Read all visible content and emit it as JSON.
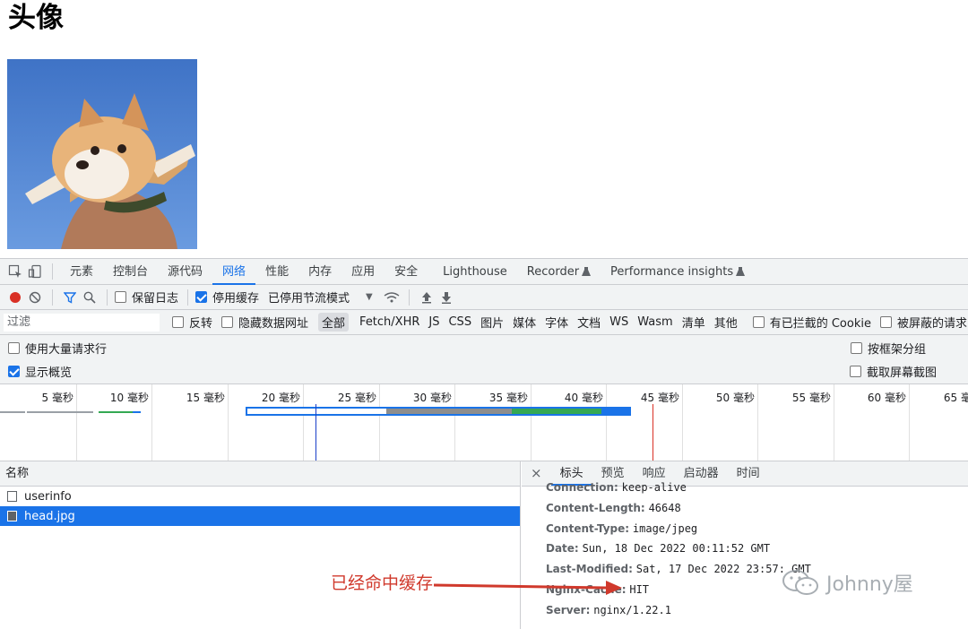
{
  "page": {
    "heading": "头像"
  },
  "devtools": {
    "main_tabs": [
      "元素",
      "控制台",
      "源代码",
      "网络",
      "性能",
      "内存",
      "应用",
      "安全",
      "Lighthouse",
      "Recorder",
      "Performance insights"
    ],
    "active_main_tab": "网络",
    "toolbar": {
      "preserve_log": "保留日志",
      "disable_cache": "停用缓存",
      "throttling": "已停用节流模式"
    },
    "filter": {
      "placeholder": "过滤",
      "invert": "反转",
      "hide_data_urls": "隐藏数据网址",
      "types": [
        "全部",
        "Fetch/XHR",
        "JS",
        "CSS",
        "图片",
        "媒体",
        "字体",
        "文档",
        "WS",
        "Wasm",
        "清单",
        "其他"
      ],
      "active_type": "全部",
      "blocked_cookies": "有已拦截的 Cookie",
      "blocked_requests": "被屏蔽的请求"
    },
    "options": {
      "big_request_rows": "使用大量请求行",
      "group_by_frame": "按框架分组",
      "show_overview": "显示概览",
      "capture_screenshots": "截取屏幕截图"
    },
    "timeline": {
      "ticks": [
        "5 毫秒",
        "10 毫秒",
        "15 毫秒",
        "20 毫秒",
        "25 毫秒",
        "30 毫秒",
        "35 毫秒",
        "40 毫秒",
        "45 毫秒",
        "50 毫秒",
        "55 毫秒",
        "60 毫秒",
        "65 毫秒"
      ]
    },
    "requests": {
      "column_name": "名称",
      "rows": [
        {
          "name": "userinfo",
          "selected": false
        },
        {
          "name": "head.jpg",
          "selected": true
        }
      ]
    },
    "details": {
      "close": "×",
      "tabs": [
        "标头",
        "预览",
        "响应",
        "启动器",
        "时间"
      ],
      "active_tab": "标头",
      "headers": [
        {
          "name": "Connection:",
          "value": "keep-alive"
        },
        {
          "name": "Content-Length:",
          "value": "46648"
        },
        {
          "name": "Content-Type:",
          "value": "image/jpeg"
        },
        {
          "name": "Date:",
          "value": "Sun, 18 Dec 2022 00:11:52 GMT"
        },
        {
          "name": "Last-Modified:",
          "value": "Sat, 17 Dec 2022 23:57:  GMT"
        },
        {
          "name": "Nginx-Cache:",
          "value": "HIT"
        },
        {
          "name": "Server:",
          "value": "nginx/1.22.1"
        }
      ]
    }
  },
  "annotation": {
    "text": "已经命中缓存",
    "color": "#d0392c"
  },
  "watermark": {
    "text": "Johnny屋"
  },
  "colors": {
    "accent": "#1a73e8",
    "record_red": "#d93025",
    "annotation_red": "#d0392c"
  }
}
